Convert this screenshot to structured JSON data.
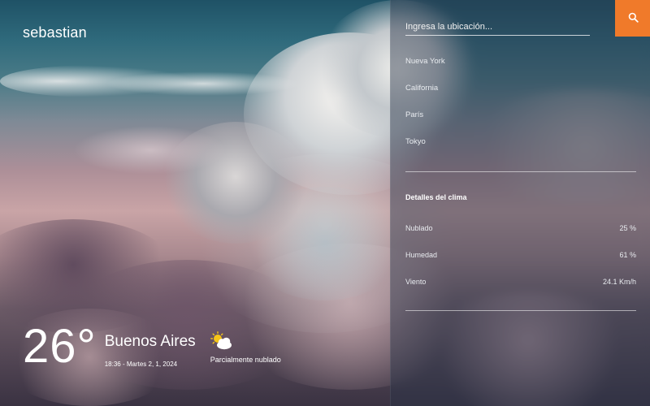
{
  "brand": "sebastian",
  "current": {
    "temperature": "26°",
    "city": "Buenos Aires",
    "datetime": "18:36 - Martes 2, 1, 2024",
    "condition": "Parcialmente nublado",
    "condition_icon": "partly-cloudy-icon"
  },
  "search": {
    "placeholder": "Ingresa la ubicación...",
    "value": "",
    "button_icon": "search-icon",
    "button_color": "#f07a2a"
  },
  "locations": [
    "Nueva York",
    "California",
    "París",
    "Tokyo"
  ],
  "details": {
    "title": "Detalles del clima",
    "rows": [
      {
        "label": "Nublado",
        "value": "25 %"
      },
      {
        "label": "Humedad",
        "value": "61 %"
      },
      {
        "label": "Viento",
        "value": "24.1 Km/h"
      }
    ]
  }
}
